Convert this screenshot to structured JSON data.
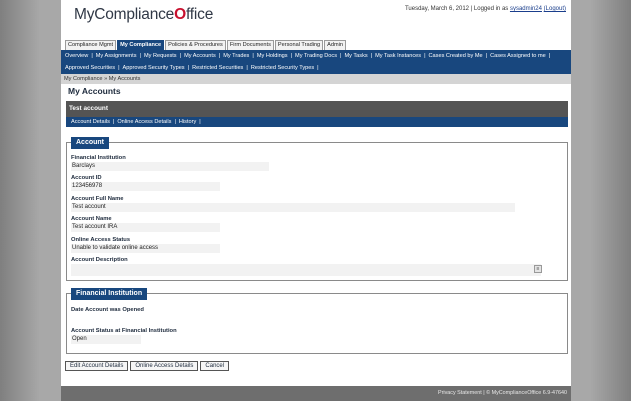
{
  "header": {
    "logo_prefix": "MyCompliance",
    "logo_check": "O",
    "logo_suffix": "ffice",
    "date": "Tuesday, March 6, 2012",
    "logged_in_prefix": "| Logged in as",
    "username": "sysadmin24",
    "logout": "(Logout)"
  },
  "tabs": [
    {
      "label": "Compliance Mgmt",
      "active": false
    },
    {
      "label": "My Compliance",
      "active": true
    },
    {
      "label": "Policies & Procedures",
      "active": false
    },
    {
      "label": "Firm Documents",
      "active": false
    },
    {
      "label": "Personal Trading",
      "active": false
    },
    {
      "label": "Admin",
      "active": false
    }
  ],
  "subnav": {
    "row1": [
      "Overview",
      "My Assignments",
      "My Requests",
      "My Accounts",
      "My Trades",
      "My Holdings",
      "My Trading Docs",
      "My Tasks",
      "My Task Instances",
      "Cases Created by Me",
      "Cases Assigned to me"
    ],
    "row2": [
      "Approved Securities",
      "Approved Security Types",
      "Restricted Securities",
      "Restricted Security Types"
    ],
    "separator": "|"
  },
  "breadcrumb": "My Compliance »  My Accounts",
  "page_title": "My Accounts",
  "record_title": "Test account",
  "record_tabs": [
    "Account Details",
    "Online Access Details",
    "History"
  ],
  "account_section": {
    "legend": "Account",
    "fields": [
      {
        "label": "Financial Institution",
        "value": "Barclays"
      },
      {
        "label": "Account ID",
        "value": "123456978"
      },
      {
        "label": "Account Full Name",
        "value": "Test account"
      },
      {
        "label": "Account Name",
        "value": "Test account IRA"
      },
      {
        "label": "Online Access Status",
        "value": "Unable to validate online access"
      },
      {
        "label": "Account Description",
        "value": ""
      }
    ]
  },
  "fi_section": {
    "legend": "Financial Institution",
    "fields": [
      {
        "label": "Date Account was Opened",
        "value": ""
      },
      {
        "label": "Account Status at Financial Institution",
        "value": "Open"
      }
    ]
  },
  "buttons": {
    "edit": "Edit Account Details",
    "online": "Online Access Details",
    "cancel": "Cancel"
  },
  "footer": "Privacy Statement   |   © MyComplianceOffice 6.9-47640",
  "colors": {
    "nav_blue": "#18477e",
    "record_bar": "#545454",
    "logo_check_red": "#c8102e"
  }
}
